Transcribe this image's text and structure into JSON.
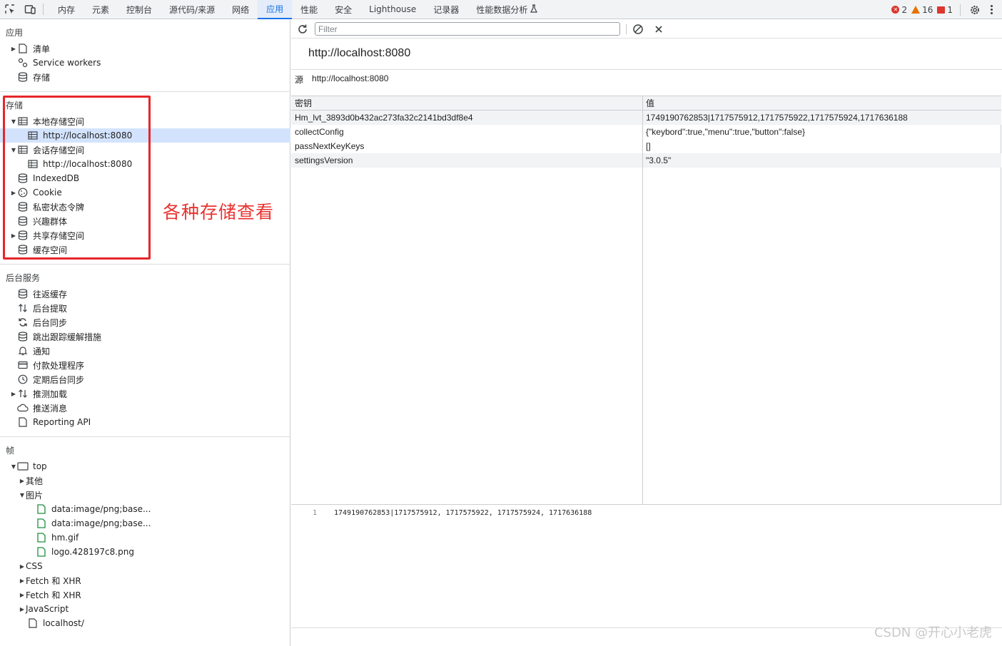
{
  "tabs": [
    {
      "label": "内存",
      "active": false
    },
    {
      "label": "元素",
      "active": false
    },
    {
      "label": "控制台",
      "active": false
    },
    {
      "label": "源代码/来源",
      "active": false
    },
    {
      "label": "网络",
      "active": false
    },
    {
      "label": "应用",
      "active": true
    },
    {
      "label": "性能",
      "active": false
    },
    {
      "label": "安全",
      "active": false
    },
    {
      "label": "Lighthouse",
      "active": false
    },
    {
      "label": "记录器",
      "active": false
    },
    {
      "label": "性能数据分析",
      "active": false
    }
  ],
  "counters": {
    "errors": "2",
    "warnings": "16",
    "issues": "1"
  },
  "sidebar": {
    "app_section": {
      "title": "应用",
      "items": [
        "清单",
        "Service workers",
        "存储"
      ]
    },
    "storage_section": {
      "title": "存储",
      "local_storage": "本地存储空间",
      "local_storage_origin": "http://localhost:8080",
      "session_storage": "会话存储空间",
      "session_storage_origin": "http://localhost:8080",
      "indexeddb": "IndexedDB",
      "cookie": "Cookie",
      "private_state_tokens": "私密状态令牌",
      "interest_groups": "兴趣群体",
      "shared_storage": "共享存储空间",
      "cache_storage": "缓存空间"
    },
    "background_section": {
      "title": "后台服务",
      "items": [
        "往返缓存",
        "后台提取",
        "后台同步",
        "跳出跟踪缓解措施",
        "通知",
        "付款处理程序",
        "定期后台同步",
        "推测加载",
        "推送消息",
        "Reporting API"
      ]
    },
    "frames_section": {
      "title": "帧",
      "top": "top",
      "other": "其他",
      "images": "图片",
      "image_files": [
        "data:image/png;base...",
        "data:image/png;base...",
        "hm.gif",
        "logo.428197c8.png"
      ],
      "css": "CSS",
      "fetch1": "Fetch 和 XHR",
      "fetch2": "Fetch 和 XHR",
      "javascript": "JavaScript",
      "localhost": "localhost/"
    },
    "annotation": "各种存储查看"
  },
  "main": {
    "filter_placeholder": "Filter",
    "origin_title": "http://localhost:8080",
    "origin_label": "源",
    "origin_value": "http://localhost:8080",
    "columns": {
      "key": "密钥",
      "value": "值"
    },
    "rows": [
      {
        "key": "Hm_lvt_3893d0b432ac273fa32c2141bd3df8e4",
        "value": "1749190762853|1717575912,1717575922,1717575924,1717636188"
      },
      {
        "key": "collectConfig",
        "value": "{\"keybord\":true,\"menu\":true,\"button\":false}"
      },
      {
        "key": "passNextKeyKeys",
        "value": "[]"
      },
      {
        "key": "settingsVersion",
        "value": "\"3.0.5\""
      }
    ],
    "preview_line_number": "1",
    "preview_text": "1749190762853|1717575912, 1717575922, 1717575924, 1717636188"
  },
  "watermark": "CSDN @开心小老虎",
  "colors": {
    "accent": "#1a73e8",
    "annotation": "#e8332f",
    "selected_row": "#d3e3fd"
  }
}
